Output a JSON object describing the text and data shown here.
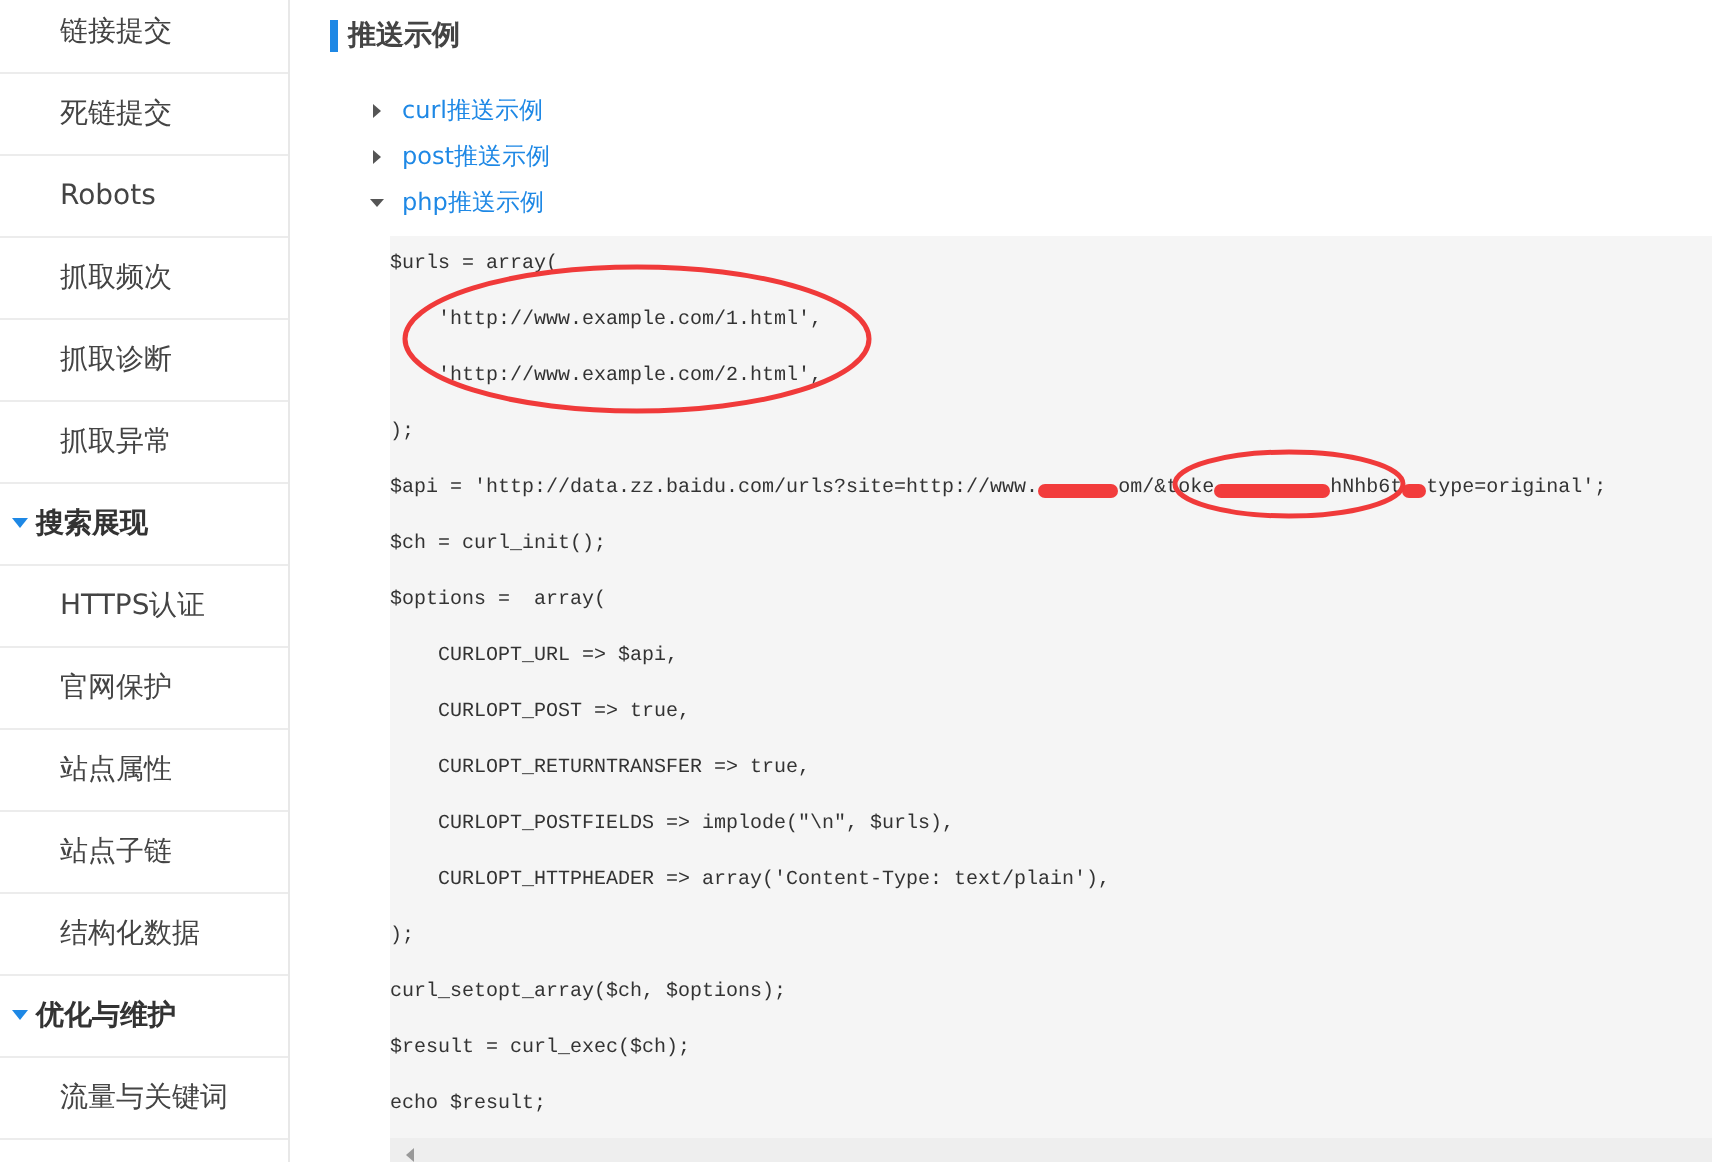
{
  "sidebar": {
    "items": [
      {
        "kind": "item",
        "label": "链接提交"
      },
      {
        "kind": "item",
        "label": "死链提交"
      },
      {
        "kind": "item",
        "label": "Robots"
      },
      {
        "kind": "item",
        "label": "抓取频次"
      },
      {
        "kind": "item",
        "label": "抓取诊断"
      },
      {
        "kind": "item",
        "label": "抓取异常"
      },
      {
        "kind": "section",
        "label": "搜索展现",
        "expanded": true
      },
      {
        "kind": "item",
        "label": "HTTPS认证"
      },
      {
        "kind": "item",
        "label": "官网保护"
      },
      {
        "kind": "item",
        "label": "站点属性"
      },
      {
        "kind": "item",
        "label": "站点子链"
      },
      {
        "kind": "item",
        "label": "结构化数据"
      },
      {
        "kind": "section",
        "label": "优化与维护",
        "expanded": true
      },
      {
        "kind": "item",
        "label": "流量与关键词"
      }
    ]
  },
  "main": {
    "title": "推送示例",
    "examples": [
      {
        "label": "curl推送示例",
        "expanded": false
      },
      {
        "label": "post推送示例",
        "expanded": false
      },
      {
        "label": "php推送示例",
        "expanded": true
      }
    ],
    "code_lines": [
      {
        "segments": [
          {
            "kind": "text",
            "text": "$urls = array("
          }
        ]
      },
      {
        "segments": [
          {
            "kind": "text",
            "text": "    'http://www.example.com/1.html',"
          }
        ]
      },
      {
        "segments": [
          {
            "kind": "text",
            "text": "    'http://www.example.com/2.html',"
          }
        ]
      },
      {
        "segments": [
          {
            "kind": "text",
            "text": ");"
          }
        ]
      },
      {
        "segments": [
          {
            "kind": "text",
            "text": "$api = 'http://data.zz.baidu.com/urls?site=http://www."
          },
          {
            "kind": "redacted"
          },
          {
            "kind": "text",
            "text": "om/&toke"
          },
          {
            "kind": "redacted"
          },
          {
            "kind": "text",
            "text": "hNhb6t"
          },
          {
            "kind": "redacted"
          },
          {
            "kind": "text",
            "text": "type=original';"
          }
        ]
      },
      {
        "segments": [
          {
            "kind": "text",
            "text": "$ch = curl_init();"
          }
        ]
      },
      {
        "segments": [
          {
            "kind": "text",
            "text": "$options =  array("
          }
        ]
      },
      {
        "segments": [
          {
            "kind": "text",
            "text": "    CURLOPT_URL => $api,"
          }
        ]
      },
      {
        "segments": [
          {
            "kind": "text",
            "text": "    CURLOPT_POST => true,"
          }
        ]
      },
      {
        "segments": [
          {
            "kind": "text",
            "text": "    CURLOPT_RETURNTRANSFER => true,"
          }
        ]
      },
      {
        "segments": [
          {
            "kind": "text",
            "text": "    CURLOPT_POSTFIELDS => implode(\"\\n\", $urls),"
          }
        ]
      },
      {
        "segments": [
          {
            "kind": "text",
            "text": "    CURLOPT_HTTPHEADER => array('Content-Type: text/plain'),"
          }
        ]
      },
      {
        "segments": [
          {
            "kind": "text",
            "text": ");"
          }
        ]
      },
      {
        "segments": [
          {
            "kind": "text",
            "text": "curl_setopt_array($ch, $options);"
          }
        ]
      },
      {
        "segments": [
          {
            "kind": "text",
            "text": "$result = curl_exec($ch);"
          }
        ]
      },
      {
        "segments": [
          {
            "kind": "text",
            "text": "echo $result;"
          }
        ]
      }
    ]
  }
}
